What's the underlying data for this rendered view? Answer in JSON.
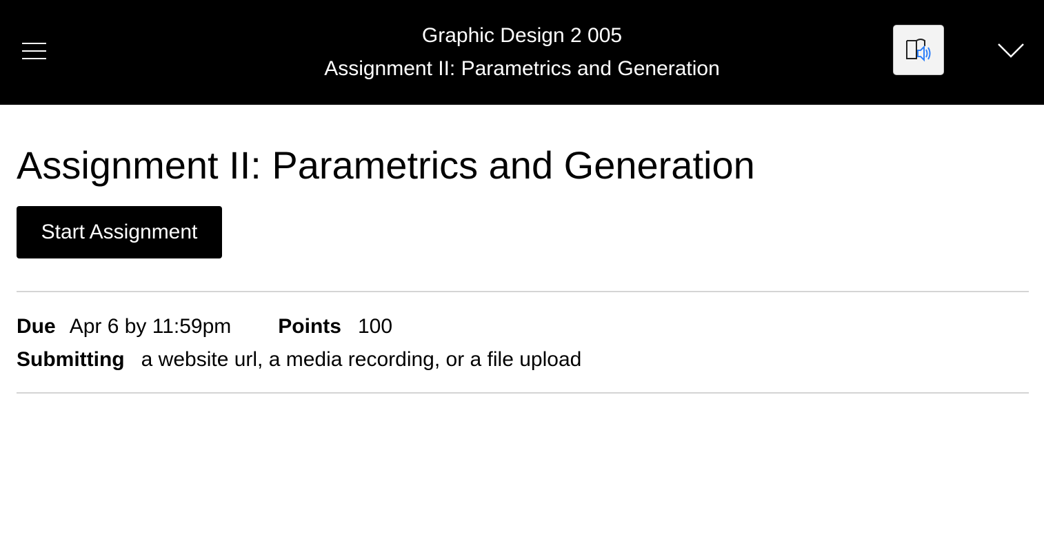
{
  "header": {
    "course_name": "Graphic Design 2 005",
    "assignment_name": "Assignment II: Parametrics and Generation",
    "menu_icon": "hamburger-menu-icon",
    "immersive_reader_icon": "immersive-reader-icon",
    "expand_icon": "chevron-down-icon",
    "background_color": "#000000",
    "accent_color": "#2d7ff9"
  },
  "main": {
    "title": "Assignment II: Parametrics and Generation",
    "start_button_label": "Start Assignment",
    "details": {
      "due_label": "Due",
      "due_value": "Apr 6 by 11:59pm",
      "points_label": "Points",
      "points_value": "100",
      "submitting_label": "Submitting",
      "submitting_value": "a website url, a media recording, or a file upload"
    }
  }
}
